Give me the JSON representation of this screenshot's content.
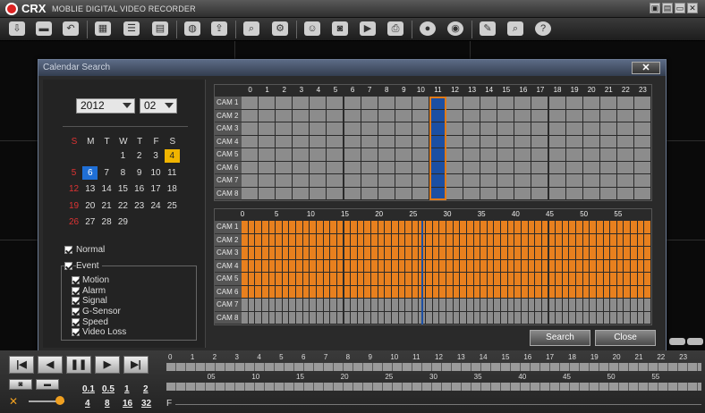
{
  "app": {
    "brand": "CRX",
    "subtitle": "MOBLIE DIGITAL VIDEO RECORDER"
  },
  "window_controls": [
    "▣",
    "▤",
    "▭",
    "✕"
  ],
  "toolbar_icons": [
    "import-icon",
    "folder-icon",
    "undo-icon",
    "grid-icon",
    "list-icon",
    "report-icon",
    "globe-icon",
    "export-icon",
    "screen-search-icon",
    "screen-settings-icon",
    "user-icon",
    "snapshot-icon",
    "video-camera-icon",
    "print-icon",
    "disc-icon",
    "backup-icon",
    "wrench-icon",
    "monitor-search-icon",
    "help-icon"
  ],
  "dialog": {
    "title": "Calendar Search",
    "close_label": "✕",
    "year": "2012",
    "month": "02",
    "weekdays": [
      "S",
      "M",
      "T",
      "W",
      "T",
      "F",
      "S"
    ],
    "weeks": [
      [
        "",
        "",
        "",
        "1",
        "2",
        "3",
        "4"
      ],
      [
        "5",
        "6",
        "7",
        "8",
        "9",
        "10",
        "11"
      ],
      [
        "12",
        "13",
        "14",
        "15",
        "16",
        "17",
        "18"
      ],
      [
        "19",
        "20",
        "21",
        "22",
        "23",
        "24",
        "25"
      ],
      [
        "26",
        "27",
        "28",
        "29",
        "",
        "",
        ""
      ]
    ],
    "today": "6",
    "highlighted": "4",
    "normal_label": "Normal",
    "event_label": "Event",
    "event_types": [
      "Motion",
      "Alarm",
      "Signal",
      "G-Sensor",
      "Speed",
      "Video Loss"
    ],
    "search_label": "Search",
    "close_btn_label": "Close"
  },
  "hour_grid": {
    "hours": [
      "0",
      "1",
      "2",
      "3",
      "4",
      "5",
      "6",
      "7",
      "8",
      "9",
      "10",
      "11",
      "12",
      "13",
      "14",
      "15",
      "16",
      "17",
      "18",
      "19",
      "20",
      "21",
      "22",
      "23"
    ],
    "cams": [
      "CAM 1",
      "CAM 2",
      "CAM 3",
      "CAM 4",
      "CAM 5",
      "CAM 6",
      "CAM 7",
      "CAM 8"
    ],
    "selected_hour": 11,
    "recorded_hour": 11,
    "recorded_cams": 8,
    "colors": {
      "empty": "#8c8c8c",
      "recorded": "#1c4fa3",
      "selected_border": "#e07a18"
    }
  },
  "minute_grid": {
    "labels": [
      "0",
      "5",
      "10",
      "15",
      "20",
      "25",
      "30",
      "35",
      "40",
      "45",
      "50",
      "55"
    ],
    "cams": [
      "CAM 1",
      "CAM 2",
      "CAM 3",
      "CAM 4",
      "CAM 5",
      "CAM 6",
      "CAM 7",
      "CAM 8"
    ],
    "recorded_cams": 6,
    "cursor_minute": 26,
    "colors": {
      "recorded": "#e8801e",
      "empty": "#8c8c8c",
      "cursor": "#1c4fa3"
    }
  },
  "playback": {
    "buttons": [
      "|◀",
      "◀",
      "❚❚",
      "▶",
      "▶|"
    ],
    "speeds_top": [
      "0.1",
      "0.5",
      "1",
      "2"
    ],
    "speeds_bottom": [
      "4",
      "8",
      "16",
      "32"
    ],
    "hour_labels": [
      "0",
      "1",
      "2",
      "3",
      "4",
      "5",
      "6",
      "7",
      "8",
      "9",
      "10",
      "11",
      "12",
      "13",
      "14",
      "15",
      "16",
      "17",
      "18",
      "19",
      "20",
      "21",
      "22",
      "23"
    ],
    "minute_labels": [
      "05",
      "10",
      "15",
      "20",
      "25",
      "30",
      "35",
      "40",
      "45",
      "50",
      "55"
    ],
    "f_label": "F"
  }
}
